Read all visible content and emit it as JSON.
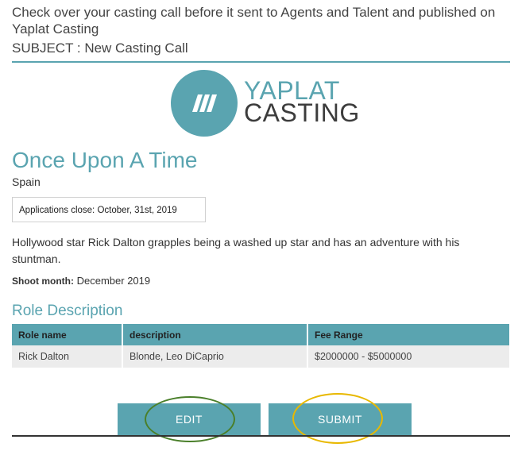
{
  "intro": "Check over your casting call before it sent to Agents and Talent and published on Yaplat Casting",
  "subject": "SUBJECT : New Casting Call",
  "logo": {
    "line1": "YAPLAT",
    "line2": "CASTING",
    "icon": "slashes-icon"
  },
  "casting": {
    "title": "Once Upon A Time",
    "location": "Spain",
    "applications_close": "Applications close: October, 31st, 2019",
    "description": "Hollywood star Rick Dalton grapples being a washed up star and has an adventure with his stuntman.",
    "shoot_month_label": "Shoot month:",
    "shoot_month_value": "December 2019"
  },
  "roles": {
    "heading": "Role Description",
    "columns": [
      "Role name",
      "description",
      "Fee Range"
    ],
    "rows": [
      [
        "Rick Dalton",
        "Blonde, Leo DiCaprio",
        "$2000000 - $5000000"
      ]
    ]
  },
  "buttons": {
    "edit": "EDIT",
    "submit": "SUBMIT"
  },
  "colors": {
    "accent": "#5aa4b0",
    "edit_highlight": "#4a7f2a",
    "submit_highlight": "#e8b800"
  }
}
